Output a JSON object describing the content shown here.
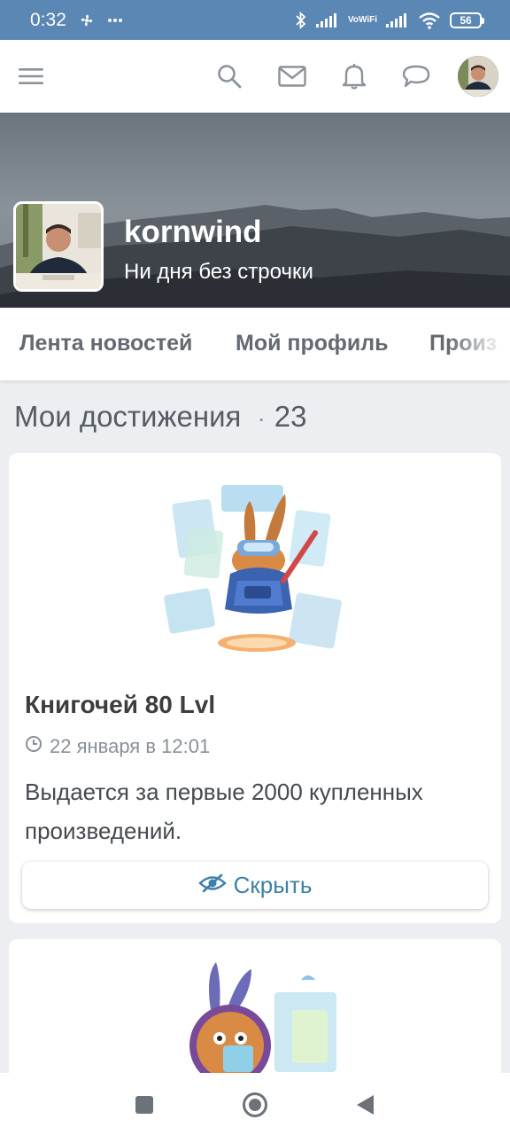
{
  "status_bar": {
    "time": "0:32",
    "vowifi_top": "Vo",
    "vowifi_bottom": "WiFi",
    "battery": "56",
    "icons": [
      "fan-icon",
      "more-dots-icon",
      "bluetooth-icon",
      "signal-icon",
      "vowifi-icon",
      "signal-icon",
      "wifi-icon",
      "battery-icon"
    ]
  },
  "header": {
    "icons": [
      "menu-icon",
      "search-icon",
      "mail-icon",
      "bell-icon",
      "chat-icon",
      "avatar"
    ]
  },
  "profile": {
    "name": "kornwind",
    "tagline": "Ни дня без строчки"
  },
  "tabs": [
    {
      "label": "Лента новостей"
    },
    {
      "label": "Мой профиль"
    },
    {
      "label": "Произ"
    }
  ],
  "section": {
    "title": "Мои достижения",
    "dot": "·",
    "count": "23"
  },
  "achievements": [
    {
      "title": "Книгочей 80 Lvl",
      "date": "22 января в 12:01",
      "description": "Выдается за первые 2000 купленных произведений.",
      "hide_label": "Скрыть"
    }
  ],
  "colors": {
    "status_bar": "#5b87b4",
    "accent": "#3f7fa8",
    "background": "#edeef2"
  },
  "nav_bar": {
    "icons": [
      "square-recents-icon",
      "circle-home-icon",
      "triangle-back-icon"
    ]
  }
}
